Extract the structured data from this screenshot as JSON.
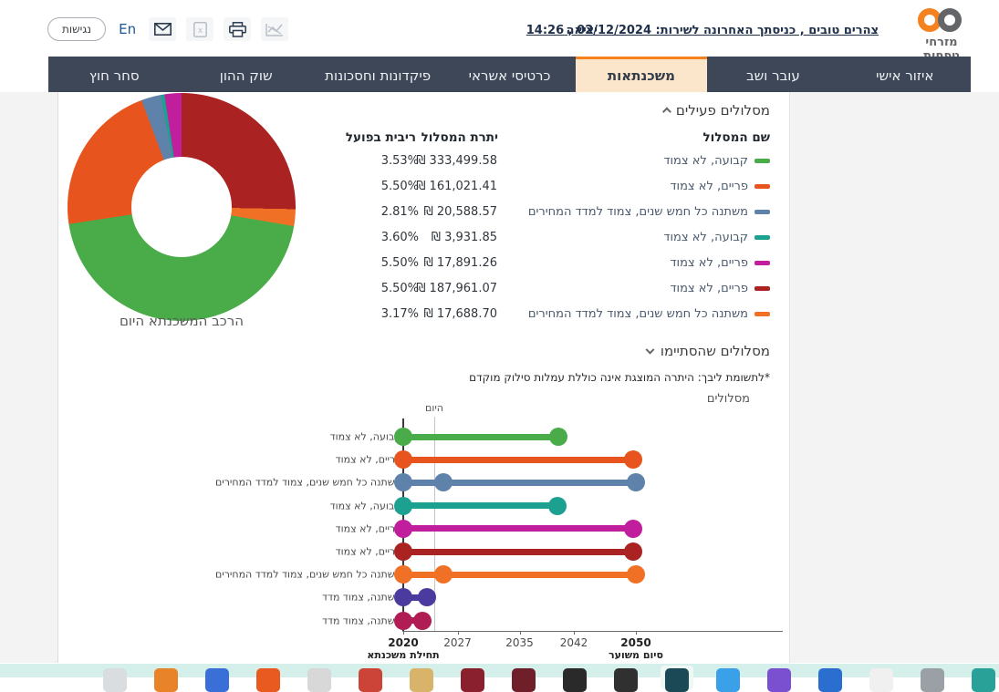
{
  "header": {
    "brand": "מזרחי טפחות",
    "greeting": "צהרים טובים , כניסתך האחרונה לשירות: 02/12/2024 , 14:26",
    "logout": "יציאה",
    "accessibility": "נגישות",
    "language": "En",
    "icons": [
      "email-icon",
      "excel-export-icon",
      "print-icon",
      "graph-icon"
    ]
  },
  "nav": {
    "tabs": [
      {
        "label": "איזור אישי",
        "active": false
      },
      {
        "label": "עובר ושב",
        "active": false
      },
      {
        "label": "משכנתאות",
        "active": true
      },
      {
        "label": "כרטיסי אשראי",
        "active": false
      },
      {
        "label": "פיקדונות וחסכונות",
        "active": false
      },
      {
        "label": "שוק ההון",
        "active": false
      },
      {
        "label": "סחר חוץ",
        "active": false
      }
    ],
    "active_color": "#f5821f",
    "active_bg": "#fbe5cb",
    "bar_bg": "#3d4757"
  },
  "sections": {
    "active_title": "מסלולים פעילים",
    "finished_title": "מסלולים שהסתיימו",
    "note": "*לתשומת ליבך: היתרה המוצגת אינה כוללת עמלות סילוק מוקדם"
  },
  "table": {
    "headers": {
      "name": "שם המסלול",
      "balance": "יתרת המסלול",
      "rate": "ריבית בפועל"
    },
    "rows": [
      {
        "name": "קבועה, לא צמוד",
        "color": "#4aac49",
        "balance": "₪ 333,499.58",
        "rate": "3.53%"
      },
      {
        "name": "פריים, לא צמוד",
        "color": "#e8541d",
        "balance": "₪ 161,021.41",
        "rate": "5.50%"
      },
      {
        "name": "משתנה כל חמש שנים, צמוד למדד המחירים",
        "color": "#5e82aa",
        "balance": "₪ 20,588.57",
        "rate": "2.81%"
      },
      {
        "name": "קבועה, לא צמוד",
        "color": "#1ca191",
        "balance": "₪ 3,931.85",
        "rate": "3.60%"
      },
      {
        "name": "פריים, לא צמוד",
        "color": "#c11e9d",
        "balance": "₪ 17,891.26",
        "rate": "5.50%"
      },
      {
        "name": "פריים, לא צמוד",
        "color": "#ab2222",
        "balance": "₪ 187,961.07",
        "rate": "5.50%"
      },
      {
        "name": "משתנה כל חמש שנים, צמוד למדד המחירים",
        "color": "#f07026",
        "balance": "₪ 17,688.70",
        "rate": "3.17%"
      }
    ]
  },
  "chart_data": [
    {
      "type": "pie",
      "title": "הרכב המשכנתא היום",
      "labels": [
        "קבועה, לא צמוד",
        "פריים, לא צמוד",
        "משתנה כל חמש שנים, צמוד למדד המחירים",
        "קבועה, לא צמוד",
        "פריים, לא צמוד",
        "פריים, לא צמוד",
        "משתנה כל חמש שנים, צמוד למדד המחירים"
      ],
      "values": [
        333499.58,
        161021.41,
        20588.57,
        3931.85,
        17891.26,
        187961.07,
        17688.7
      ],
      "colors": [
        "#4aac49",
        "#e8541d",
        "#5e82aa",
        "#1ca191",
        "#c11e9d",
        "#ab2222",
        "#f07026"
      ],
      "slice_order_clockwise_from_top": [
        5,
        6,
        0,
        1,
        2,
        3,
        4
      ],
      "donut_hole_ratio": 0.44,
      "legend_position": "none"
    },
    {
      "type": "timeline",
      "title": "מסלולים",
      "today_label": "היום",
      "today_year": 2024,
      "ticks": [
        {
          "year": 2020,
          "label": "2020",
          "bold": true,
          "sub": "תחילת משכנתא"
        },
        {
          "year": 2027,
          "label": "2027",
          "bold": false,
          "sub": ""
        },
        {
          "year": 2035,
          "label": "2035",
          "bold": false,
          "sub": ""
        },
        {
          "year": 2042,
          "label": "2042",
          "bold": false,
          "sub": ""
        },
        {
          "year": 2050,
          "label": "2050",
          "bold": true,
          "sub": "סיום משוער"
        }
      ],
      "x_range": [
        2020,
        2050
      ],
      "rows": [
        {
          "label": "קבועה, לא צמוד",
          "color": "#4aac49",
          "start": 2020,
          "end": 2040,
          "markers": []
        },
        {
          "label": "פריים, לא צמוד",
          "color": "#e8541d",
          "start": 2020,
          "end": 2049.7,
          "markers": []
        },
        {
          "label": "משתנה כל חמש שנים, צמוד למדד המחירים",
          "color": "#5e82aa",
          "start": 2020,
          "end": 2050,
          "markers": [
            2025.2
          ]
        },
        {
          "label": "קבועה, לא צמוד",
          "color": "#1ca191",
          "start": 2020,
          "end": 2039.9,
          "markers": []
        },
        {
          "label": "פריים, לא צמוד",
          "color": "#c11e9d",
          "start": 2020,
          "end": 2049.7,
          "markers": []
        },
        {
          "label": "פריים, לא צמוד",
          "color": "#ab2222",
          "start": 2020,
          "end": 2049.7,
          "markers": []
        },
        {
          "label": "משתנה כל חמש שנים, צמוד למדד המחירים",
          "color": "#f07026",
          "start": 2020,
          "end": 2050,
          "markers": [
            2025.2
          ]
        },
        {
          "label": "משתנה, צמוד מדד",
          "color": "#4b3b9e",
          "start": 2020,
          "end": 2023,
          "markers": []
        },
        {
          "label": "משתנה, צמוד מדד",
          "color": "#b01d55",
          "start": 2020,
          "end": 2022.5,
          "markers": []
        }
      ]
    }
  ],
  "taskbar": {
    "bg": "#d5efea",
    "active_index": 11,
    "icon_colors": [
      "#d9dde0",
      "#e8832a",
      "#3a6fd8",
      "#e85a20",
      "#d8d8d8",
      "#cc4438",
      "#d8b46a",
      "#8a1f2d",
      "#6f1f2a",
      "#2a2a2a",
      "#303030",
      "#1b4a56",
      "#3aa0e8",
      "#7a4fd0",
      "#2a6fd0",
      "#f0f0f0",
      "#9aa0a6",
      "#2aa198",
      "#4a90d9",
      "#3tbd"
    ]
  }
}
